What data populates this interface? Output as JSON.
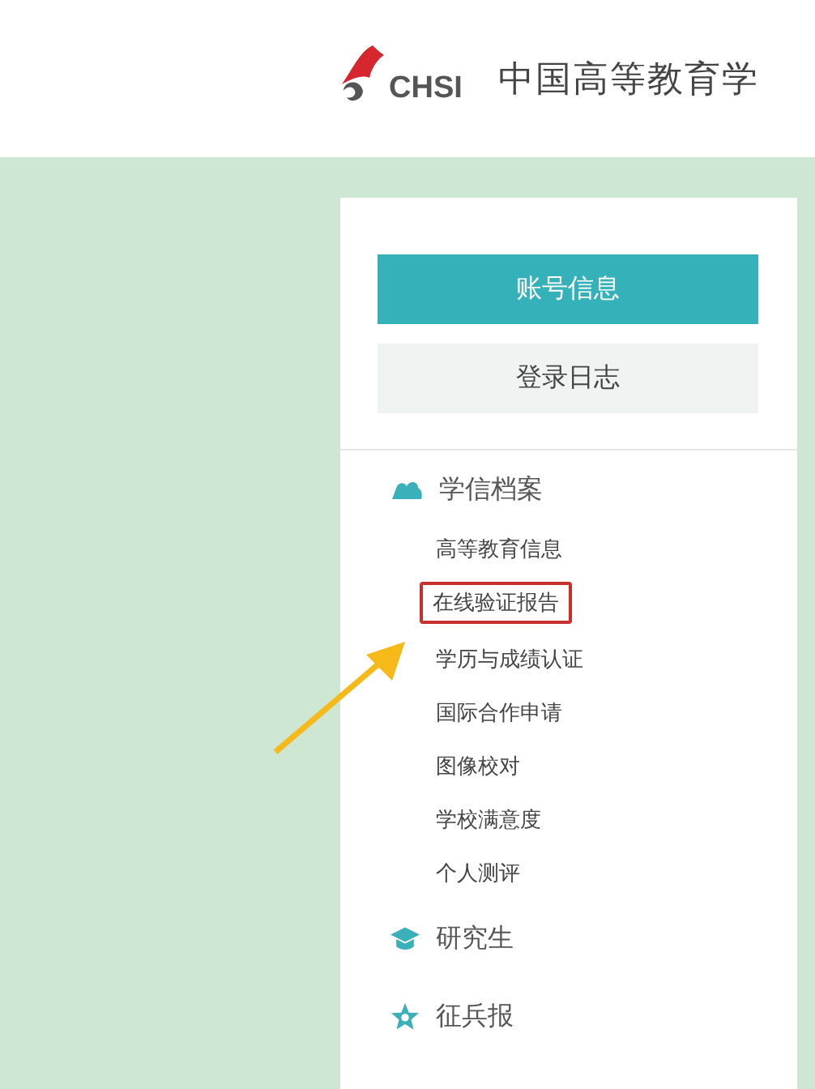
{
  "header": {
    "logo_text": "CHSI",
    "title": "中国高等教育学"
  },
  "account": {
    "buttons": [
      {
        "label": "账号信息",
        "selected": true
      },
      {
        "label": "登录日志",
        "selected": false
      }
    ]
  },
  "sections": [
    {
      "title": "学信档案",
      "kind": "cloud",
      "items": [
        {
          "label": "高等教育信息",
          "highlighted": false
        },
        {
          "label": "在线验证报告",
          "highlighted": true
        },
        {
          "label": "学历与成绩认证",
          "highlighted": false
        },
        {
          "label": "国际合作申请",
          "highlighted": false
        },
        {
          "label": "图像校对",
          "highlighted": false
        },
        {
          "label": "学校满意度",
          "highlighted": false
        },
        {
          "label": "个人测评",
          "highlighted": false
        }
      ]
    },
    {
      "title": "研究生",
      "kind": "cap"
    },
    {
      "title": "征兵报",
      "kind": "star"
    }
  ]
}
